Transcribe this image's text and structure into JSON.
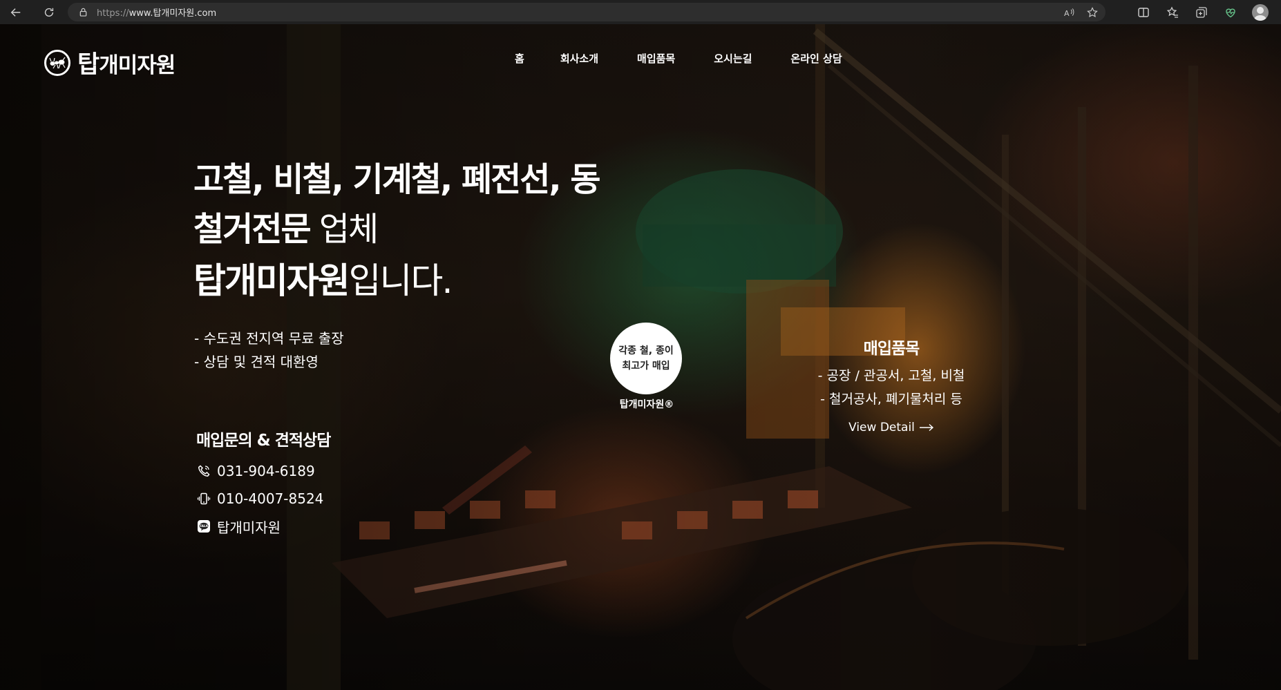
{
  "browser": {
    "url_scheme": "https://",
    "url_host": "www.탑개미자원.com"
  },
  "header": {
    "logo_text_big": "탑",
    "logo_text": "개미자원",
    "menu": [
      "홈",
      "회사소개",
      "매입품목",
      "오시는길",
      "온라인 상담"
    ]
  },
  "hero": {
    "line1": "고철, 비철, 기계철, 폐전선, 동",
    "line2_bold": "철거전문",
    "line2_normal": " 업체",
    "line3_bold": "탑개미자원",
    "line3_normal": "입니다.",
    "bullets": [
      "- 수도권 전지역 무료 출장",
      "- 상담 및 견적 대환영"
    ]
  },
  "contact": {
    "title": "매입문의 & 견적상담",
    "phone": "031-904-6189",
    "mobile": "010-4007-8524",
    "kakao": "탑개미자원"
  },
  "badge": {
    "line1": "각종 철, 종이",
    "line2": "최고가 매입",
    "caption": "탑개미자원®"
  },
  "products": {
    "title": "매입품목",
    "lines": [
      "- 공장 / 관공서, 고철, 비철",
      "- 철거공사, 폐기물처리 등"
    ],
    "link": "View Detail"
  },
  "colors": {
    "chrome_bg": "#202020",
    "address_bg": "#2e2e2e",
    "text": "#ffffff"
  }
}
